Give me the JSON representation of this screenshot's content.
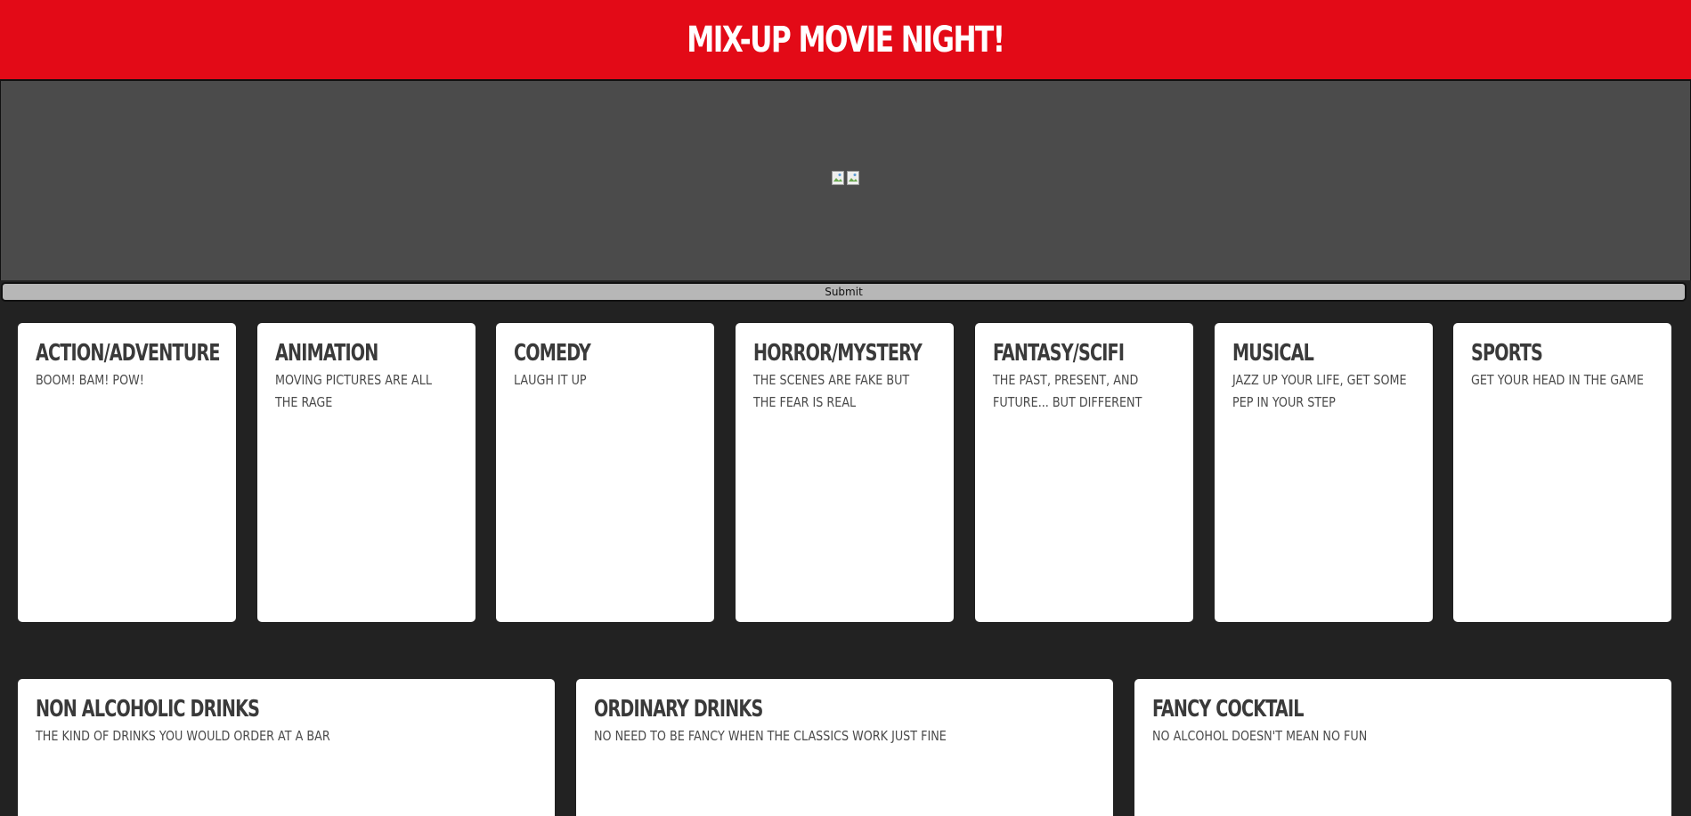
{
  "header": {
    "title": "MIX-UP MOVIE NIGHT!"
  },
  "preview": {
    "images": [
      {
        "alt": "",
        "icon": "broken-image-icon"
      },
      {
        "alt": "",
        "icon": "broken-image-icon"
      }
    ]
  },
  "form": {
    "submit_label": "Submit"
  },
  "genres": [
    {
      "title": "ACTION/ADVENTURE",
      "desc": "BOOM! BAM! POW!"
    },
    {
      "title": "ANIMATION",
      "desc": "MOVING PICTURES ARE ALL THE RAGE"
    },
    {
      "title": "COMEDY",
      "desc": "LAUGH IT UP"
    },
    {
      "title": "HORROR/MYSTERY",
      "desc": "THE SCENES ARE FAKE BUT THE FEAR IS REAL"
    },
    {
      "title": "FANTASY/SCIFI",
      "desc": "THE PAST, PRESENT, AND FUTURE... BUT DIFFERENT"
    },
    {
      "title": "MUSICAL",
      "desc": "JAZZ UP YOUR LIFE, GET SOME PEP IN YOUR STEP"
    },
    {
      "title": "SPORTS",
      "desc": "GET YOUR HEAD IN THE GAME"
    }
  ],
  "drinks": [
    {
      "title": "NON ALCOHOLIC DRINKS",
      "desc": "THE KIND OF DRINKS YOU WOULD ORDER AT A BAR"
    },
    {
      "title": "ORDINARY DRINKS",
      "desc": "NO NEED TO BE FANCY WHEN THE CLASSICS WORK JUST FINE"
    },
    {
      "title": "FANCY COCKTAIL",
      "desc": "NO ALCOHOL DOESN'T MEAN NO FUN"
    }
  ],
  "colors": {
    "header_bg": "#e30a17",
    "page_bg": "#222222",
    "preview_bg": "#4b4b4b",
    "button_bg": "#b7b7b7",
    "card_bg": "#ffffff"
  }
}
